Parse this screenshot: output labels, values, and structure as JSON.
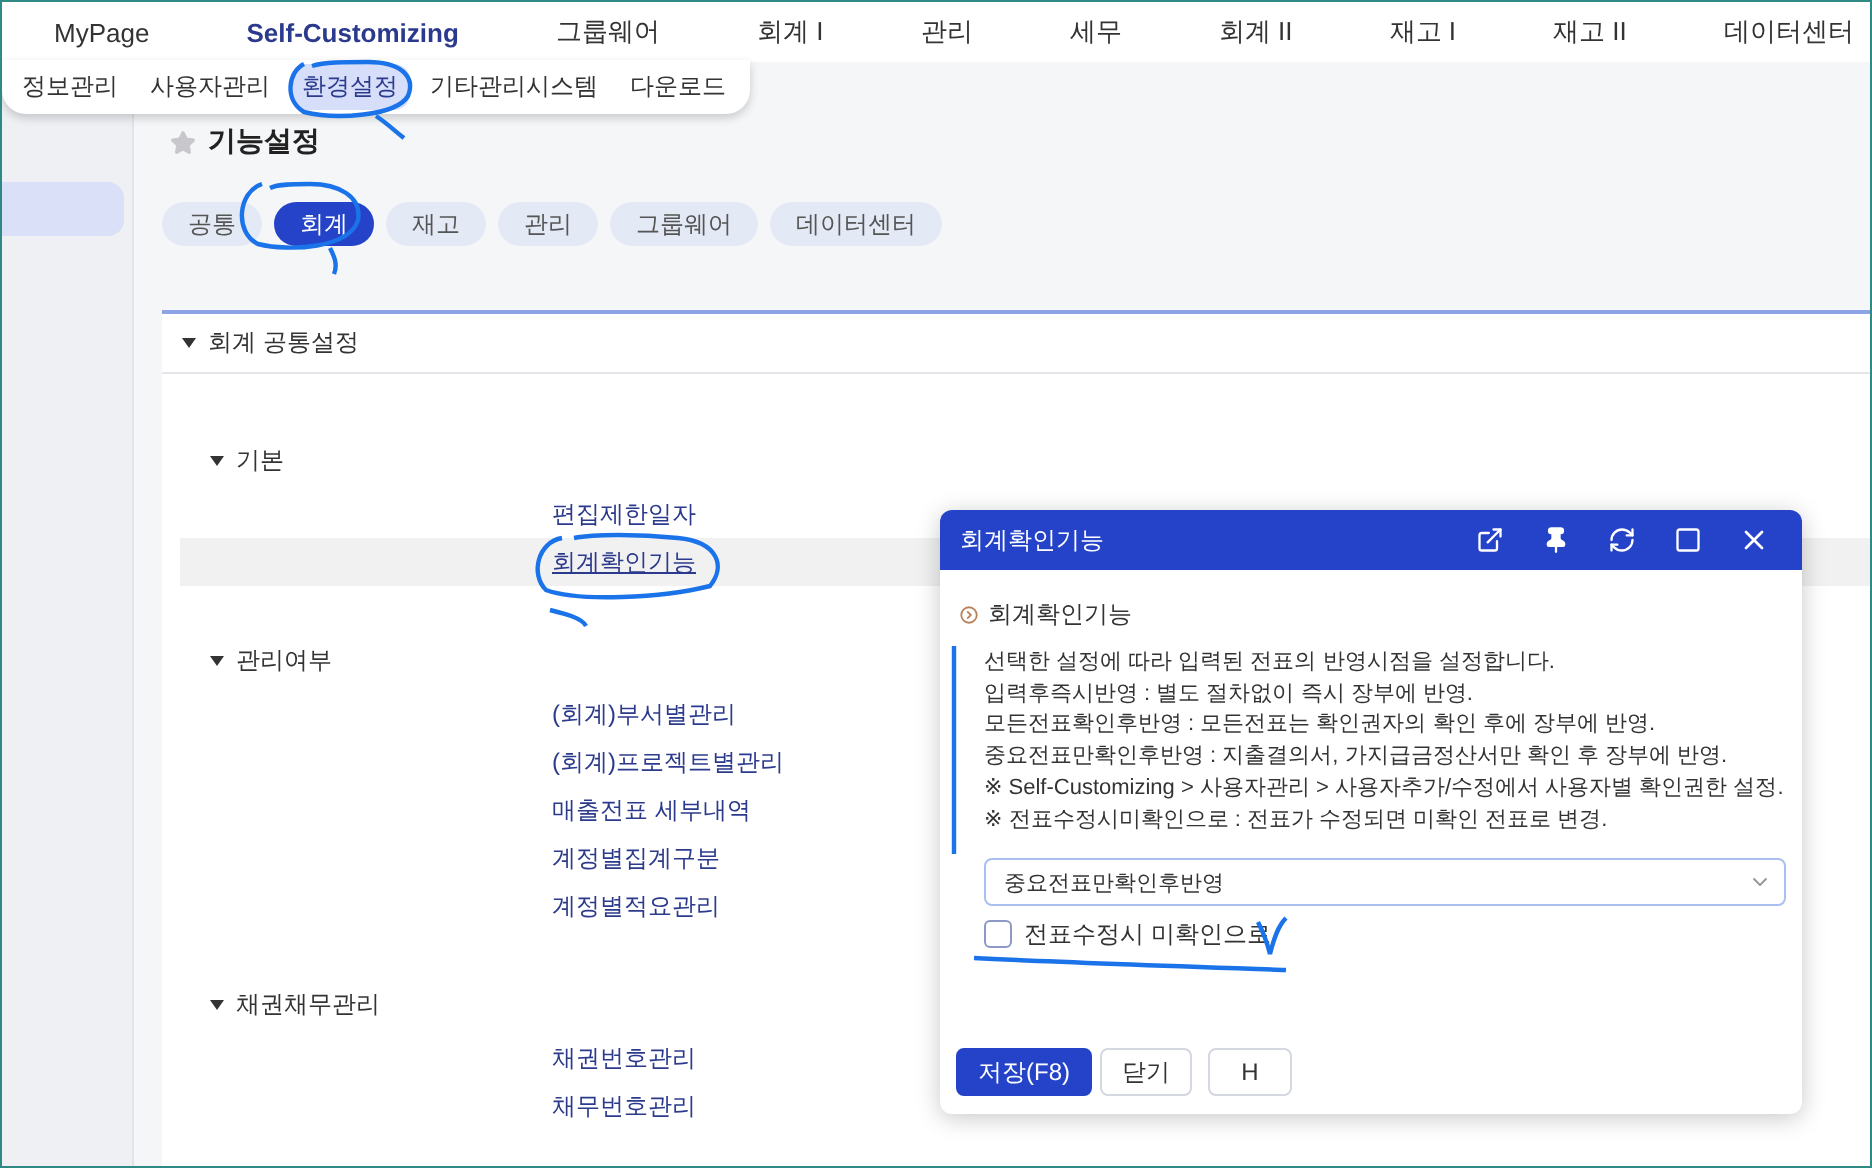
{
  "top_menu": [
    {
      "label": "MyPage",
      "selected": false
    },
    {
      "label": "Self-Customizing",
      "selected": true
    },
    {
      "label": "그룹웨어",
      "selected": false
    },
    {
      "label": "회계 I",
      "selected": false
    },
    {
      "label": "관리",
      "selected": false
    },
    {
      "label": "세무",
      "selected": false
    },
    {
      "label": "회계 II",
      "selected": false
    },
    {
      "label": "재고 I",
      "selected": false
    },
    {
      "label": "재고 II",
      "selected": false
    },
    {
      "label": "데이터센터",
      "selected": false
    }
  ],
  "sub_menu": [
    {
      "label": "정보관리",
      "selected": false
    },
    {
      "label": "사용자관리",
      "selected": false
    },
    {
      "label": "환경설정",
      "selected": true
    },
    {
      "label": "기타관리시스템",
      "selected": false
    },
    {
      "label": "다운로드",
      "selected": false
    }
  ],
  "sidebar": {
    "items": [
      {
        "selected": true
      }
    ]
  },
  "page": {
    "title": "기능설정",
    "favorite": false
  },
  "category_tabs": [
    {
      "label": "공통",
      "selected": false
    },
    {
      "label": "회계",
      "selected": true
    },
    {
      "label": "재고",
      "selected": false
    },
    {
      "label": "관리",
      "selected": false
    },
    {
      "label": "그룹웨어",
      "selected": false
    },
    {
      "label": "데이터센터",
      "selected": false
    }
  ],
  "section": {
    "title": "회계 공통설정",
    "expanded": true,
    "groups": [
      {
        "title": "기본",
        "expanded": true,
        "items": [
          {
            "label": "편집제한일자",
            "selected": false
          },
          {
            "label": "회계확인기능",
            "selected": true
          }
        ]
      },
      {
        "title": "관리여부",
        "expanded": true,
        "items": [
          {
            "label": "(회계)부서별관리",
            "selected": false
          },
          {
            "label": "(회계)프로젝트별관리",
            "selected": false
          },
          {
            "label": "매출전표 세부내역",
            "selected": false
          },
          {
            "label": "계정별집계구분",
            "selected": false
          },
          {
            "label": "계정별적요관리",
            "selected": false
          }
        ]
      },
      {
        "title": "채권채무관리",
        "expanded": true,
        "items": [
          {
            "label": "채권번호관리",
            "selected": false
          },
          {
            "label": "채무번호관리",
            "selected": false
          }
        ]
      }
    ]
  },
  "dialog": {
    "title": "회계확인기능",
    "heading": "회계확인기능",
    "description": [
      "선택한 설정에 따라 입력된 전표의 반영시점을 설정합니다.",
      "입력후즉시반영 : 별도 절차없이 즉시 장부에 반영.",
      "모든전표확인후반영 : 모든전표는 확인권자의 확인 후에 장부에 반영.",
      "중요전표만확인후반영 : 지출결의서, 가지급금정산서만 확인 후 장부에 반영.",
      "※ Self-Customizing > 사용자관리 > 사용자추가/수정에서 사용자별 확인권한 설정.",
      "※ 전표수정시미확인으로 : 전표가 수정되면 미확인 전표로 변경."
    ],
    "select": {
      "value": "중요전표만확인후반영"
    },
    "checkbox": {
      "label": "전표수정시 미확인으로",
      "checked": false
    },
    "buttons": [
      {
        "label": "저장(F8)",
        "kind": "primary"
      },
      {
        "label": "닫기",
        "kind": "default"
      },
      {
        "label": "H",
        "kind": "default"
      }
    ]
  }
}
